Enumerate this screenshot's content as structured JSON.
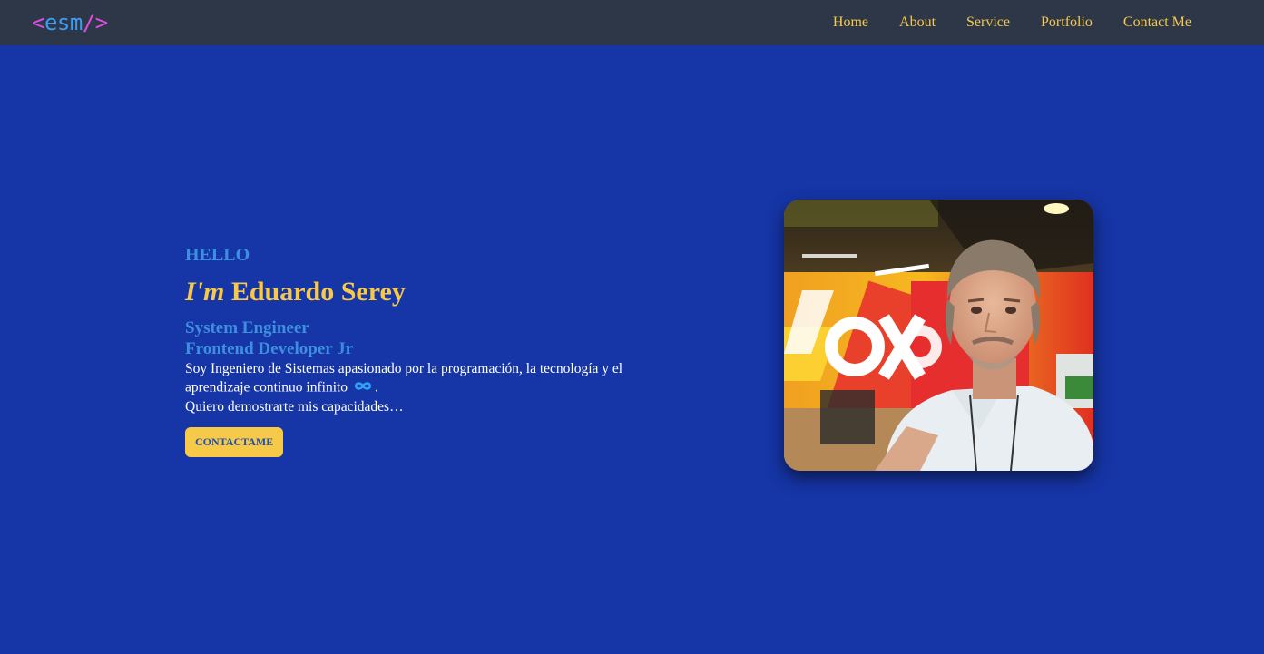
{
  "logo": {
    "open": "<",
    "name": "esm",
    "close": "/>"
  },
  "nav": {
    "items": [
      {
        "label": "Home"
      },
      {
        "label": "About"
      },
      {
        "label": "Service"
      },
      {
        "label": "Portfolio"
      },
      {
        "label": "Contact Me"
      }
    ]
  },
  "hero": {
    "greeting": "HELLO",
    "im": "I'm",
    "name": "Eduardo Serey",
    "roles": [
      "System Engineer",
      "Frontend Developer Jr"
    ],
    "description_1": "Soy Ingeniero de Sistemas apasionado por la programación, la tecnología y el aprendizaje continuo infinito",
    "description_1_end": ".",
    "description_2": "Quiero demostrarte mis capacidades…",
    "cta_label": "CONTACTAME",
    "infinity_icon": "infinity-icon"
  },
  "colors": {
    "background": "#1635a6",
    "navbar": "#2d3748",
    "accent_yellow": "#f7c948",
    "accent_blue": "#3d8fe0",
    "logo_pink": "#d94fe0"
  }
}
